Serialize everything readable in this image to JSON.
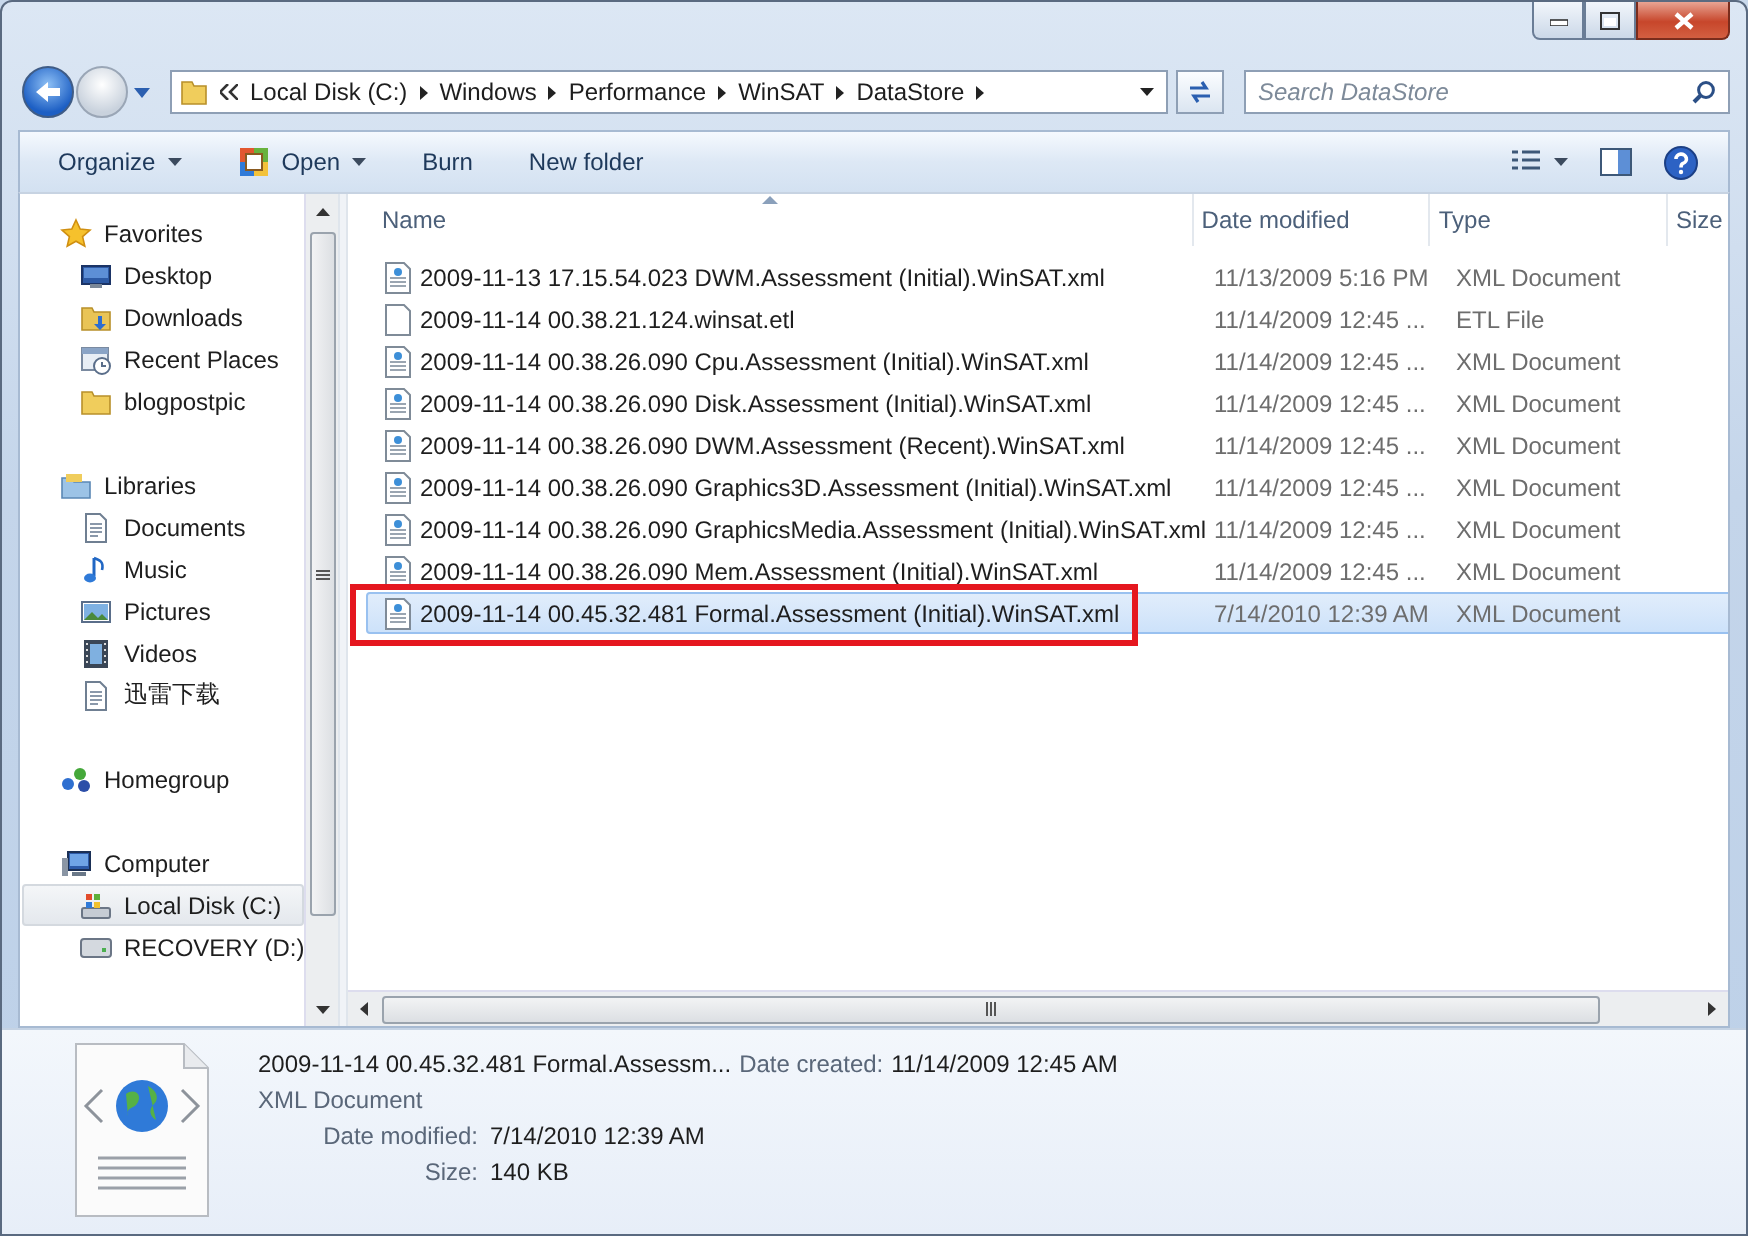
{
  "address_bar": {
    "crumbs": [
      "Local Disk (C:)",
      "Windows",
      "Performance",
      "WinSAT",
      "DataStore"
    ]
  },
  "search": {
    "placeholder": "Search DataStore"
  },
  "toolbar": {
    "items": [
      {
        "label": "Organize",
        "kind": "plain",
        "dropdown": true
      },
      {
        "label": "Open",
        "kind": "app",
        "dropdown": true
      },
      {
        "label": "Burn",
        "kind": "plain",
        "dropdown": false
      },
      {
        "label": "New folder",
        "kind": "plain",
        "dropdown": false
      }
    ]
  },
  "sidebar": {
    "groups": [
      {
        "label": "Favorites",
        "kind": "star",
        "selected": false,
        "children": [
          {
            "label": "Desktop",
            "kind": "desktop",
            "selected": false
          },
          {
            "label": "Downloads",
            "kind": "downloads",
            "selected": false
          },
          {
            "label": "Recent Places",
            "kind": "recent",
            "selected": false
          },
          {
            "label": "blogpostpic",
            "kind": "folder",
            "selected": false
          }
        ]
      },
      {
        "label": "Libraries",
        "kind": "libraries",
        "selected": false,
        "children": [
          {
            "label": "Documents",
            "kind": "documents",
            "selected": false
          },
          {
            "label": "Music",
            "kind": "music",
            "selected": false
          },
          {
            "label": "Pictures",
            "kind": "pictures",
            "selected": false
          },
          {
            "label": "Videos",
            "kind": "videos",
            "selected": false
          },
          {
            "label": "迅雷下载",
            "kind": "documents",
            "selected": false
          }
        ]
      },
      {
        "label": "Homegroup",
        "kind": "homegroup",
        "selected": false
      },
      {
        "label": "Computer",
        "kind": "computer",
        "selected": false,
        "children": [
          {
            "label": "Local Disk (C:)",
            "kind": "system-drive",
            "selected": true
          },
          {
            "label": "RECOVERY (D:)",
            "kind": "drive",
            "selected": false
          }
        ]
      }
    ]
  },
  "table": {
    "columns": [
      {
        "label": "Name",
        "sorted": true
      },
      {
        "label": "Date modified",
        "sorted": false
      },
      {
        "label": "Type",
        "sorted": false
      },
      {
        "label": "Size",
        "sorted": false
      }
    ],
    "rows": [
      {
        "name": "2009-11-13 17.15.54.023 DWM.Assessment (Initial).WinSAT.xml",
        "date": "11/13/2009 5:16 PM",
        "type": "XML Document",
        "kind": "xml",
        "selected": false,
        "outlined": false
      },
      {
        "name": "2009-11-14 00.38.21.124.winsat.etl",
        "date": "11/14/2009 12:45 ...",
        "type": "ETL File",
        "kind": "blank",
        "selected": false,
        "outlined": false
      },
      {
        "name": "2009-11-14 00.38.26.090 Cpu.Assessment (Initial).WinSAT.xml",
        "date": "11/14/2009 12:45 ...",
        "type": "XML Document",
        "kind": "xml",
        "selected": false,
        "outlined": false
      },
      {
        "name": "2009-11-14 00.38.26.090 Disk.Assessment (Initial).WinSAT.xml",
        "date": "11/14/2009 12:45 ...",
        "type": "XML Document",
        "kind": "xml",
        "selected": false,
        "outlined": false
      },
      {
        "name": "2009-11-14 00.38.26.090 DWM.Assessment (Recent).WinSAT.xml",
        "date": "11/14/2009 12:45 ...",
        "type": "XML Document",
        "kind": "xml",
        "selected": false,
        "outlined": false
      },
      {
        "name": "2009-11-14 00.38.26.090 Graphics3D.Assessment (Initial).WinSAT.xml",
        "date": "11/14/2009 12:45 ...",
        "type": "XML Document",
        "kind": "xml",
        "selected": false,
        "outlined": false
      },
      {
        "name": "2009-11-14 00.38.26.090 GraphicsMedia.Assessment (Initial).WinSAT.xml",
        "date": "11/14/2009 12:45 ...",
        "type": "XML Document",
        "kind": "xml",
        "selected": false,
        "outlined": false
      },
      {
        "name": "2009-11-14 00.38.26.090 Mem.Assessment (Initial).WinSAT.xml",
        "date": "11/14/2009 12:45 ...",
        "type": "XML Document",
        "kind": "xml",
        "selected": false,
        "outlined": false
      },
      {
        "name": "2009-11-14 00.45.32.481 Formal.Assessment (Initial).WinSAT.xml",
        "date": "7/14/2010 12:39 AM",
        "type": "XML Document",
        "kind": "xml",
        "selected": true,
        "outlined": true
      }
    ]
  },
  "details": {
    "name": "2009-11-14 00.45.32.481 Formal.Assessm...",
    "type": "XML Document",
    "fields": [
      {
        "label": "Date created:",
        "value": "11/14/2009 12:45 AM",
        "kind": "inline"
      },
      {
        "label": "Date modified:",
        "value": "7/14/2010 12:39 AM",
        "kind": "row"
      },
      {
        "label": "Size:",
        "value": "140 KB",
        "kind": "row"
      }
    ]
  }
}
